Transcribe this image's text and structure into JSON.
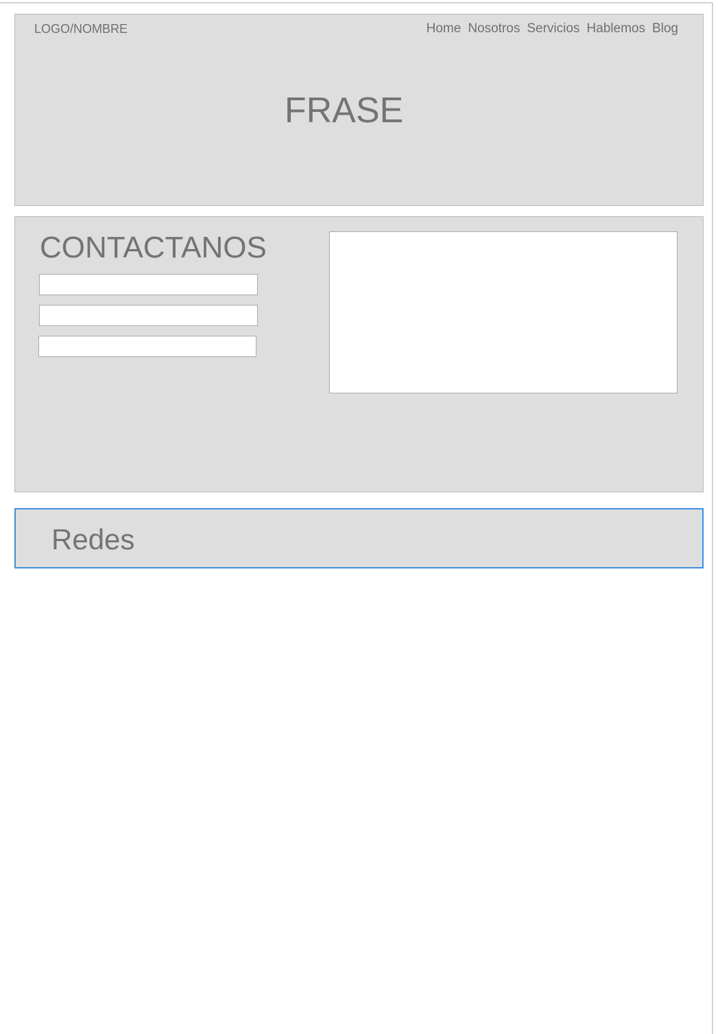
{
  "header": {
    "logo": "LOGO/NOMBRE",
    "nav": [
      {
        "label": "Home"
      },
      {
        "label": "Nosotros"
      },
      {
        "label": "Servicios"
      },
      {
        "label": "Hablemos"
      },
      {
        "label": "Blog"
      }
    ],
    "phrase": "FRASE"
  },
  "contact": {
    "title": "CONTACTANOS",
    "fields": [
      {
        "value": "",
        "placeholder": ""
      },
      {
        "value": "",
        "placeholder": ""
      },
      {
        "value": "",
        "placeholder": ""
      }
    ],
    "message": {
      "value": "",
      "placeholder": ""
    }
  },
  "social": {
    "title": "Redes",
    "selected_border_color": "#3f8fe0"
  },
  "colors": {
    "panel_background": "#dedede",
    "panel_border": "#b9b9b9",
    "text": "#747474"
  }
}
